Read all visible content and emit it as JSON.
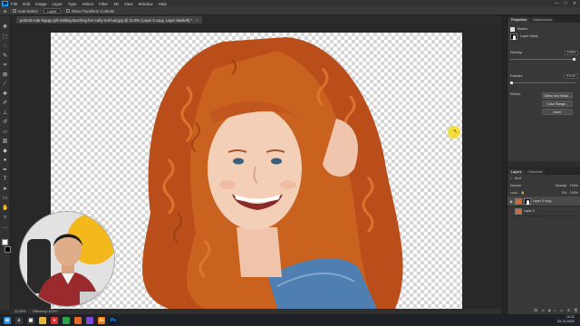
{
  "app": {
    "logo": "Ps"
  },
  "menu": [
    "File",
    "Edit",
    "Image",
    "Layer",
    "Type",
    "Select",
    "Filter",
    "3D",
    "View",
    "Window",
    "Help"
  ],
  "window_controls": {
    "minimize": "—",
    "maximize": "□",
    "close": "✕"
  },
  "options_bar": {
    "auto_select_label": "Auto-Select:",
    "auto_select_value": "Layer",
    "show_transform_label": "Show Transform Controls"
  },
  "document": {
    "tab_title": "portrait-cute-happy-girl-smiling-touching-her-curly-red-hair.jpg @ 21.6% (Layer 0 copy, Layer Mask/8) *",
    "tab_close": "×"
  },
  "status": {
    "zoom": "21.69%",
    "efficiency": "Efficiency: 100%*"
  },
  "panels": {
    "properties_tab": "Properties",
    "adjustments_tab": "Adjustments",
    "mask_section": "Masks",
    "layer_mask_label": "Layer Mask",
    "density_label": "Density:",
    "density_value": "100%",
    "feather_label": "Feather:",
    "feather_value": "0.0 px",
    "refine_label": "Refine:",
    "btn_select_mask": "Select and Mask...",
    "btn_color_range": "Color Range...",
    "btn_invert": "Invert"
  },
  "layers_panel": {
    "layers_tab": "Layers",
    "channels_tab": "Channels",
    "kind_label": "Kind",
    "blend_mode": "Normal",
    "opacity_label": "Opacity:",
    "opacity_value": "100%",
    "lock_label": "Lock:",
    "fill_label": "Fill:",
    "fill_value": "100%",
    "layers": [
      {
        "name": "Layer 0 copy",
        "selected": true
      },
      {
        "name": "Layer 0",
        "selected": false
      }
    ]
  },
  "taskbar": {
    "time": "10:11",
    "date": "25.12.2022"
  },
  "colors": {
    "accent": "#31a8ff",
    "hair": "#c2561f",
    "highlight": "#f5dc2b"
  }
}
